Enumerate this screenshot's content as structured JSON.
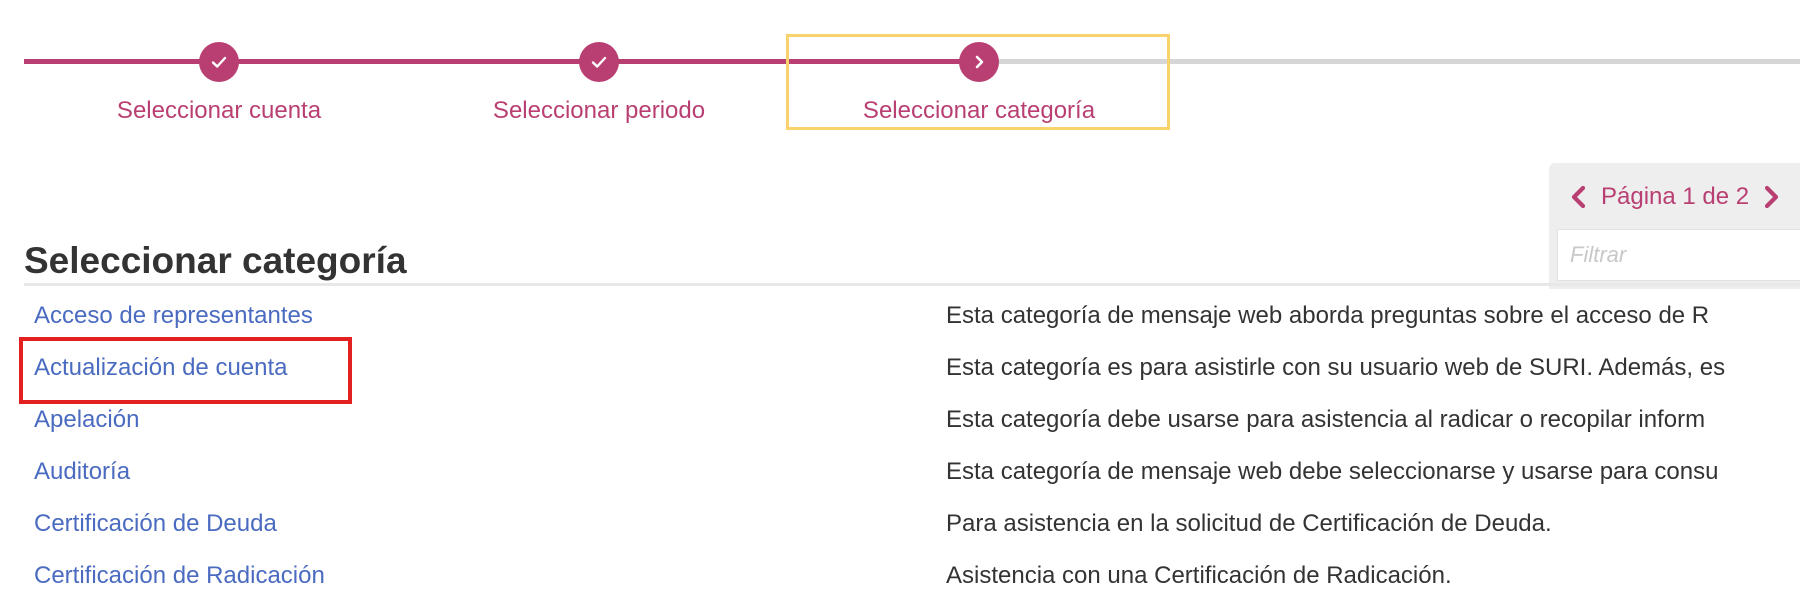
{
  "colors": {
    "accent": "#b93f73",
    "inactive": "#d6d6d6",
    "link": "#4a6bc0",
    "highlight_step": "#f9d26b",
    "highlight_selected": "#e32020"
  },
  "stepper": {
    "steps": [
      {
        "label": "Seleccionar cuenta",
        "state": "completed",
        "icon": "check-icon"
      },
      {
        "label": "Seleccionar periodo",
        "state": "completed",
        "icon": "check-icon"
      },
      {
        "label": "Seleccionar categoría",
        "state": "current",
        "icon": "chevron-right-icon"
      }
    ]
  },
  "page": {
    "title": "Seleccionar categoría"
  },
  "pager": {
    "text": "Página 1 de 2",
    "prev_icon": "chevron-left-icon",
    "next_icon": "chevron-right-icon"
  },
  "filter": {
    "placeholder": "Filtrar",
    "value": ""
  },
  "categories": [
    {
      "name": "Acceso de representantes",
      "description": "Esta categoría de mensaje web aborda preguntas sobre el acceso de R"
    },
    {
      "name": "Actualización de cuenta",
      "description": "Esta categoría es para asistirle con su usuario web de SURI. Además, es"
    },
    {
      "name": "Apelación",
      "description": "Esta categoría debe usarse para asistencia al radicar o recopilar inform"
    },
    {
      "name": "Auditoría",
      "description": "Esta categoría de mensaje web debe seleccionarse y usarse para consu"
    },
    {
      "name": "Certificación de Deuda",
      "description": "Para asistencia en la solicitud de Certificación de Deuda."
    },
    {
      "name": "Certificación de Radicación",
      "description": "Asistencia con una Certificación de Radicación."
    }
  ]
}
